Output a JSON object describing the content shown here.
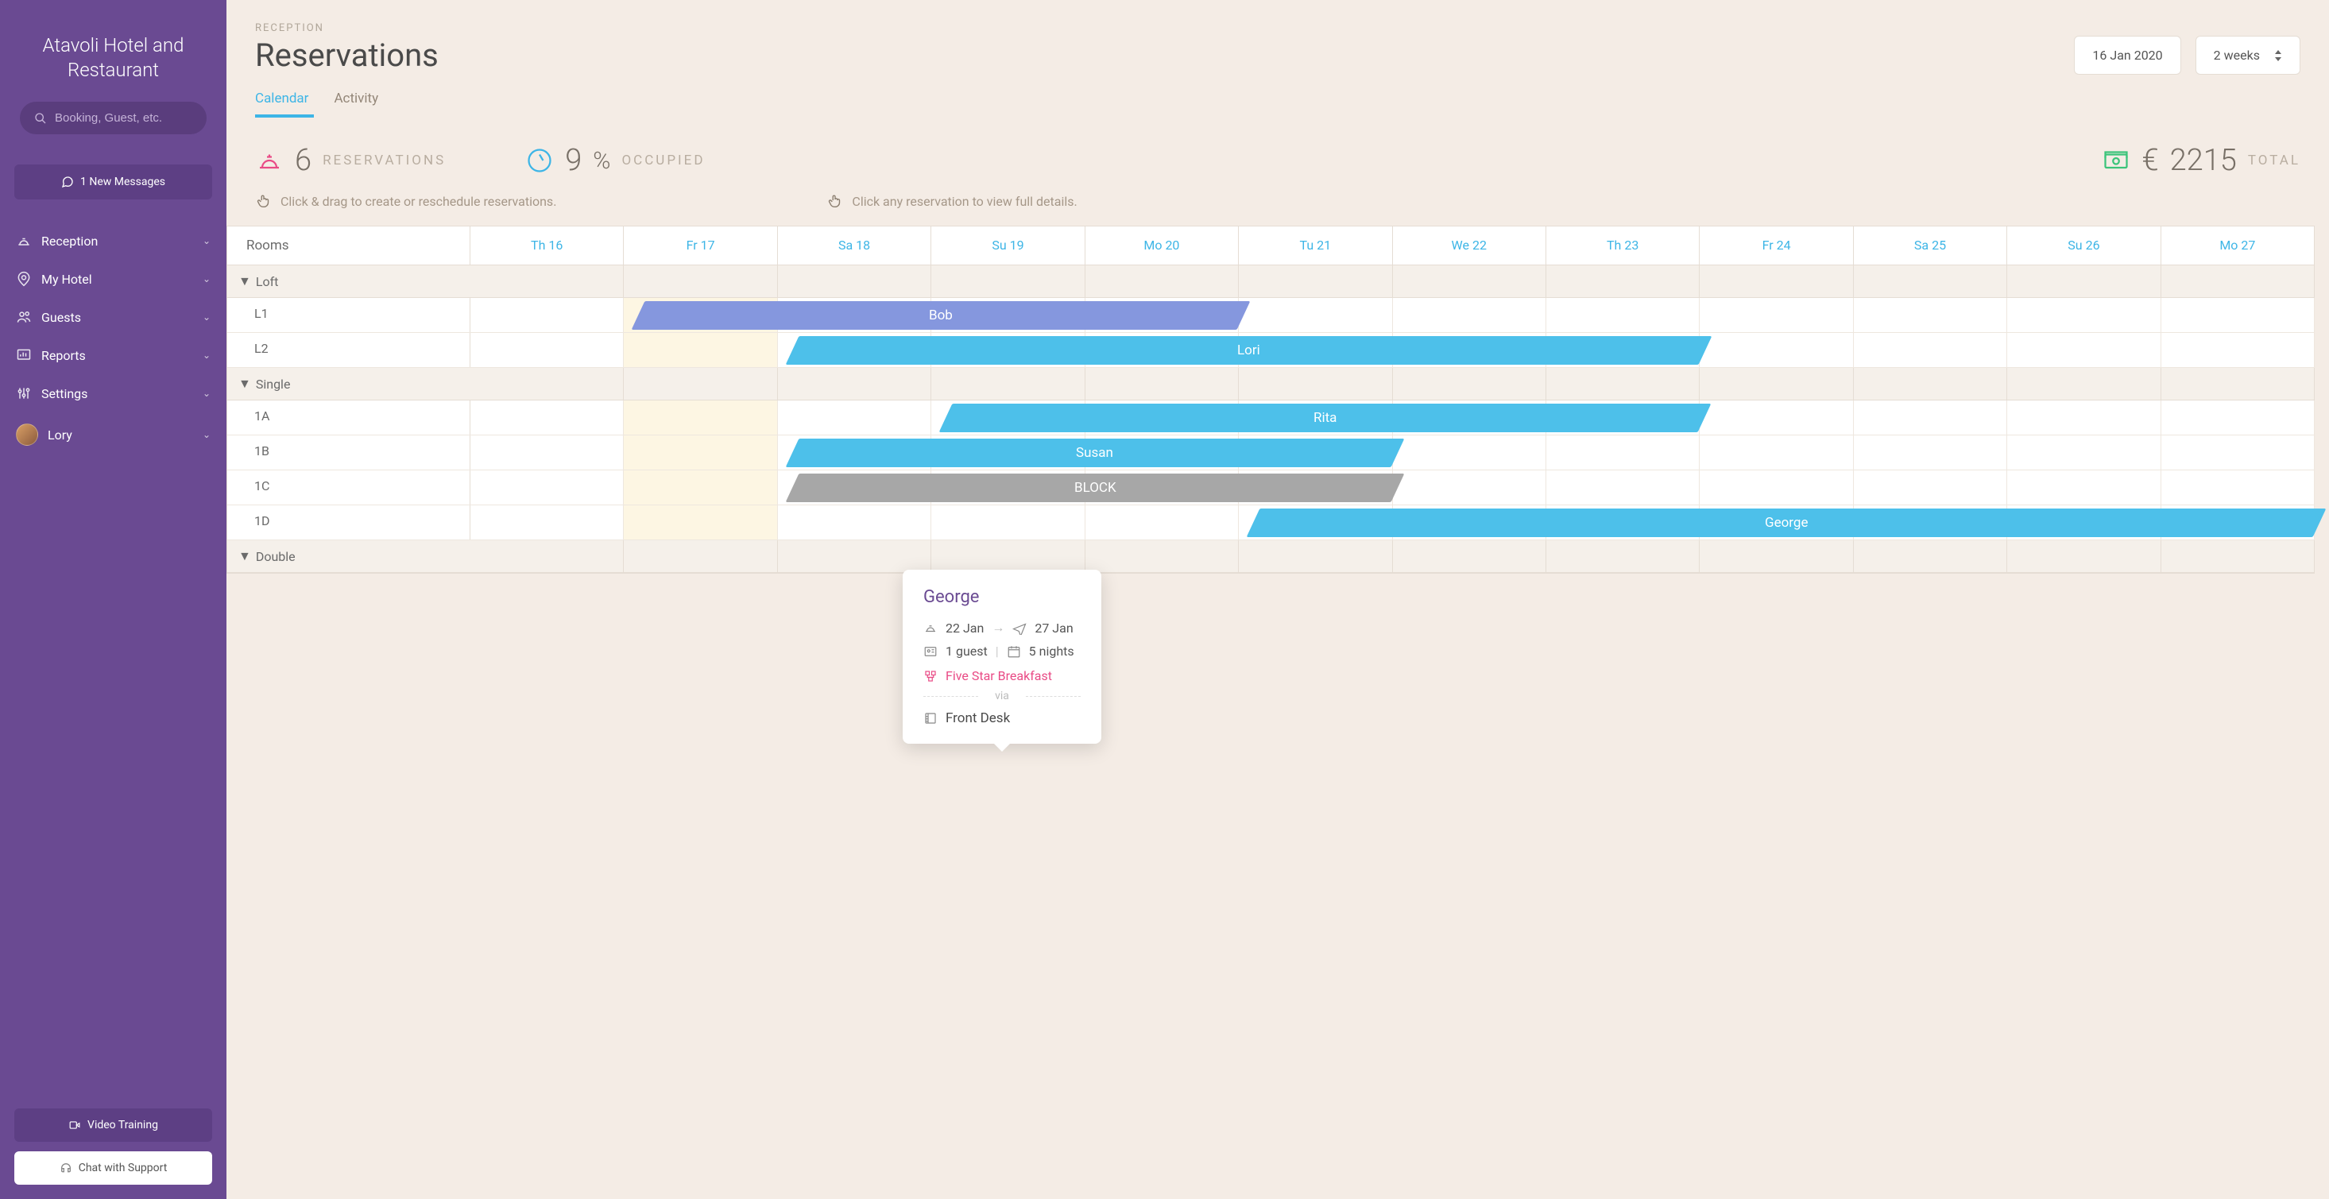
{
  "sidebar": {
    "title": "Atavoli Hotel and Restaurant",
    "search_placeholder": "Booking, Guest, etc.",
    "messages_btn": "1 New Messages",
    "nav": [
      {
        "label": "Reception",
        "icon": "bell"
      },
      {
        "label": "My Hotel",
        "icon": "pin"
      },
      {
        "label": "Guests",
        "icon": "users"
      },
      {
        "label": "Reports",
        "icon": "chart"
      },
      {
        "label": "Settings",
        "icon": "sliders"
      }
    ],
    "user": "Lory",
    "footer": {
      "video": "Video Training",
      "chat": "Chat with Support"
    }
  },
  "header": {
    "crumb": "RECEPTION",
    "title": "Reservations",
    "date": "16 Jan 2020",
    "range": "2 weeks",
    "tabs": [
      "Calendar",
      "Activity"
    ],
    "active_tab": 0
  },
  "stats": {
    "reservations": {
      "value": "6",
      "label": "RESERVATIONS"
    },
    "occupied": {
      "value": "9",
      "unit": "%",
      "label": "OCCUPIED"
    },
    "total": {
      "currency": "€",
      "value": "2215",
      "label": "TOTAL"
    }
  },
  "hints": {
    "drag": "Click & drag to create or reschedule reservations.",
    "click": "Click any reservation to view full details."
  },
  "calendar": {
    "rooms_header": "Rooms",
    "days": [
      "Th 16",
      "Fr 17",
      "Sa 18",
      "Su 19",
      "Mo 20",
      "Tu 21",
      "We 22",
      "Th 23",
      "Fr 24",
      "Sa 25",
      "Su 26",
      "Mo 27"
    ],
    "today_index": 1,
    "groups": [
      {
        "name": "Loft",
        "rooms": [
          {
            "name": "L1",
            "bars": [
              {
                "label": "Bob",
                "start": 1,
                "span": 4,
                "color": "blue"
              }
            ]
          },
          {
            "name": "L2",
            "bars": [
              {
                "label": "Lori",
                "start": 2,
                "span": 6,
                "color": "cyan"
              }
            ]
          }
        ]
      },
      {
        "name": "Single",
        "rooms": [
          {
            "name": "1A",
            "bars": [
              {
                "label": "Rita",
                "start": 3,
                "span": 5,
                "color": "cyan"
              }
            ]
          },
          {
            "name": "1B",
            "bars": [
              {
                "label": "Susan",
                "start": 2,
                "span": 4,
                "color": "cyan"
              }
            ]
          },
          {
            "name": "1C",
            "bars": [
              {
                "label": "BLOCK",
                "start": 2,
                "span": 4,
                "color": "gray"
              }
            ]
          },
          {
            "name": "1D",
            "bars": [
              {
                "label": "George",
                "start": 5,
                "span": 7,
                "color": "cyan"
              }
            ]
          }
        ]
      },
      {
        "name": "Double",
        "rooms": []
      }
    ]
  },
  "tooltip": {
    "name": "George",
    "checkin": "22 Jan",
    "checkout": "27 Jan",
    "guests": "1 guest",
    "nights": "5 nights",
    "plan": "Five Star Breakfast",
    "via": "via",
    "source": "Front Desk"
  }
}
